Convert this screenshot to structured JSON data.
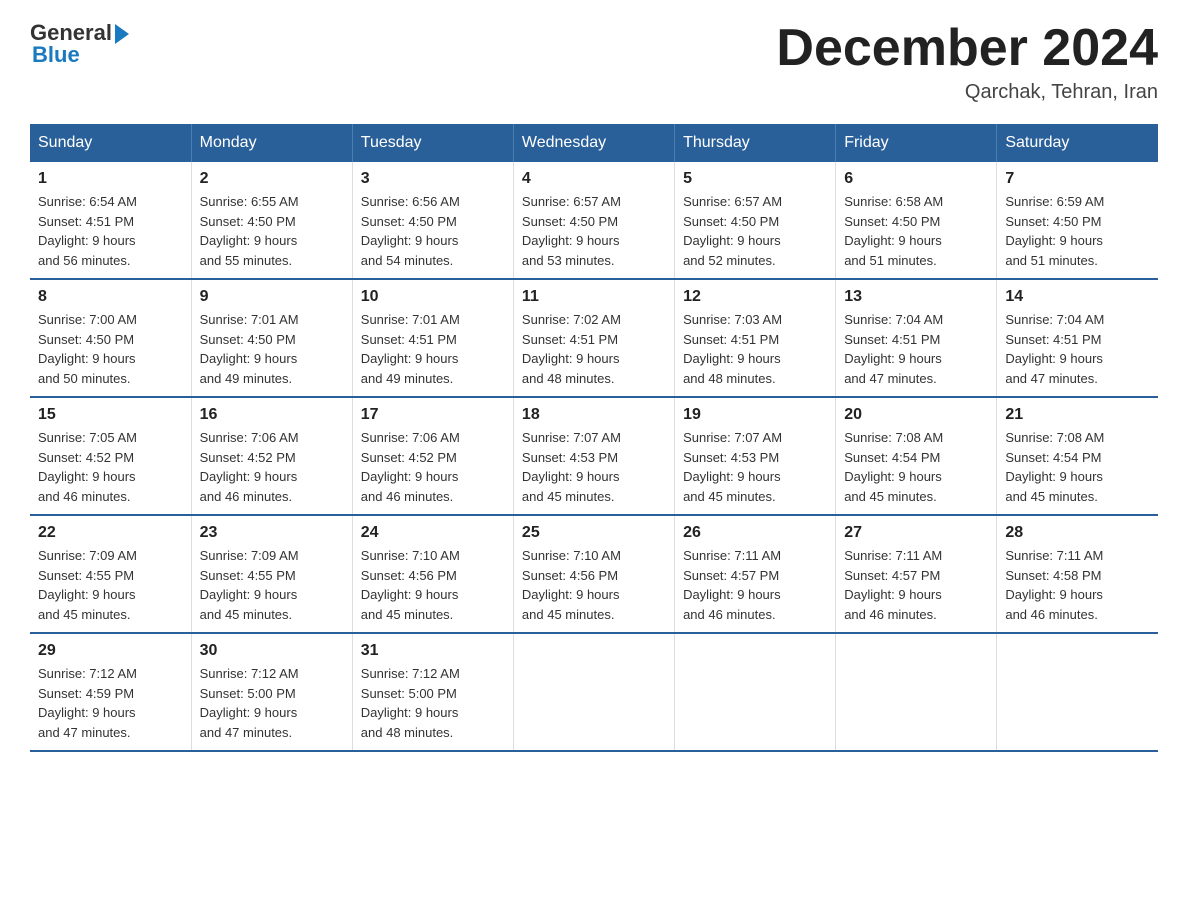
{
  "header": {
    "logo_general": "General",
    "logo_blue": "Blue",
    "title": "December 2024",
    "location": "Qarchak, Tehran, Iran"
  },
  "days_of_week": [
    "Sunday",
    "Monday",
    "Tuesday",
    "Wednesday",
    "Thursday",
    "Friday",
    "Saturday"
  ],
  "weeks": [
    [
      {
        "day": "1",
        "sunrise": "6:54 AM",
        "sunset": "4:51 PM",
        "daylight": "9 hours and 56 minutes."
      },
      {
        "day": "2",
        "sunrise": "6:55 AM",
        "sunset": "4:50 PM",
        "daylight": "9 hours and 55 minutes."
      },
      {
        "day": "3",
        "sunrise": "6:56 AM",
        "sunset": "4:50 PM",
        "daylight": "9 hours and 54 minutes."
      },
      {
        "day": "4",
        "sunrise": "6:57 AM",
        "sunset": "4:50 PM",
        "daylight": "9 hours and 53 minutes."
      },
      {
        "day": "5",
        "sunrise": "6:57 AM",
        "sunset": "4:50 PM",
        "daylight": "9 hours and 52 minutes."
      },
      {
        "day": "6",
        "sunrise": "6:58 AM",
        "sunset": "4:50 PM",
        "daylight": "9 hours and 51 minutes."
      },
      {
        "day": "7",
        "sunrise": "6:59 AM",
        "sunset": "4:50 PM",
        "daylight": "9 hours and 51 minutes."
      }
    ],
    [
      {
        "day": "8",
        "sunrise": "7:00 AM",
        "sunset": "4:50 PM",
        "daylight": "9 hours and 50 minutes."
      },
      {
        "day": "9",
        "sunrise": "7:01 AM",
        "sunset": "4:50 PM",
        "daylight": "9 hours and 49 minutes."
      },
      {
        "day": "10",
        "sunrise": "7:01 AM",
        "sunset": "4:51 PM",
        "daylight": "9 hours and 49 minutes."
      },
      {
        "day": "11",
        "sunrise": "7:02 AM",
        "sunset": "4:51 PM",
        "daylight": "9 hours and 48 minutes."
      },
      {
        "day": "12",
        "sunrise": "7:03 AM",
        "sunset": "4:51 PM",
        "daylight": "9 hours and 48 minutes."
      },
      {
        "day": "13",
        "sunrise": "7:04 AM",
        "sunset": "4:51 PM",
        "daylight": "9 hours and 47 minutes."
      },
      {
        "day": "14",
        "sunrise": "7:04 AM",
        "sunset": "4:51 PM",
        "daylight": "9 hours and 47 minutes."
      }
    ],
    [
      {
        "day": "15",
        "sunrise": "7:05 AM",
        "sunset": "4:52 PM",
        "daylight": "9 hours and 46 minutes."
      },
      {
        "day": "16",
        "sunrise": "7:06 AM",
        "sunset": "4:52 PM",
        "daylight": "9 hours and 46 minutes."
      },
      {
        "day": "17",
        "sunrise": "7:06 AM",
        "sunset": "4:52 PM",
        "daylight": "9 hours and 46 minutes."
      },
      {
        "day": "18",
        "sunrise": "7:07 AM",
        "sunset": "4:53 PM",
        "daylight": "9 hours and 45 minutes."
      },
      {
        "day": "19",
        "sunrise": "7:07 AM",
        "sunset": "4:53 PM",
        "daylight": "9 hours and 45 minutes."
      },
      {
        "day": "20",
        "sunrise": "7:08 AM",
        "sunset": "4:54 PM",
        "daylight": "9 hours and 45 minutes."
      },
      {
        "day": "21",
        "sunrise": "7:08 AM",
        "sunset": "4:54 PM",
        "daylight": "9 hours and 45 minutes."
      }
    ],
    [
      {
        "day": "22",
        "sunrise": "7:09 AM",
        "sunset": "4:55 PM",
        "daylight": "9 hours and 45 minutes."
      },
      {
        "day": "23",
        "sunrise": "7:09 AM",
        "sunset": "4:55 PM",
        "daylight": "9 hours and 45 minutes."
      },
      {
        "day": "24",
        "sunrise": "7:10 AM",
        "sunset": "4:56 PM",
        "daylight": "9 hours and 45 minutes."
      },
      {
        "day": "25",
        "sunrise": "7:10 AM",
        "sunset": "4:56 PM",
        "daylight": "9 hours and 45 minutes."
      },
      {
        "day": "26",
        "sunrise": "7:11 AM",
        "sunset": "4:57 PM",
        "daylight": "9 hours and 46 minutes."
      },
      {
        "day": "27",
        "sunrise": "7:11 AM",
        "sunset": "4:57 PM",
        "daylight": "9 hours and 46 minutes."
      },
      {
        "day": "28",
        "sunrise": "7:11 AM",
        "sunset": "4:58 PM",
        "daylight": "9 hours and 46 minutes."
      }
    ],
    [
      {
        "day": "29",
        "sunrise": "7:12 AM",
        "sunset": "4:59 PM",
        "daylight": "9 hours and 47 minutes."
      },
      {
        "day": "30",
        "sunrise": "7:12 AM",
        "sunset": "5:00 PM",
        "daylight": "9 hours and 47 minutes."
      },
      {
        "day": "31",
        "sunrise": "7:12 AM",
        "sunset": "5:00 PM",
        "daylight": "9 hours and 48 minutes."
      },
      null,
      null,
      null,
      null
    ]
  ],
  "labels": {
    "sunrise": "Sunrise:",
    "sunset": "Sunset:",
    "daylight": "Daylight:"
  }
}
